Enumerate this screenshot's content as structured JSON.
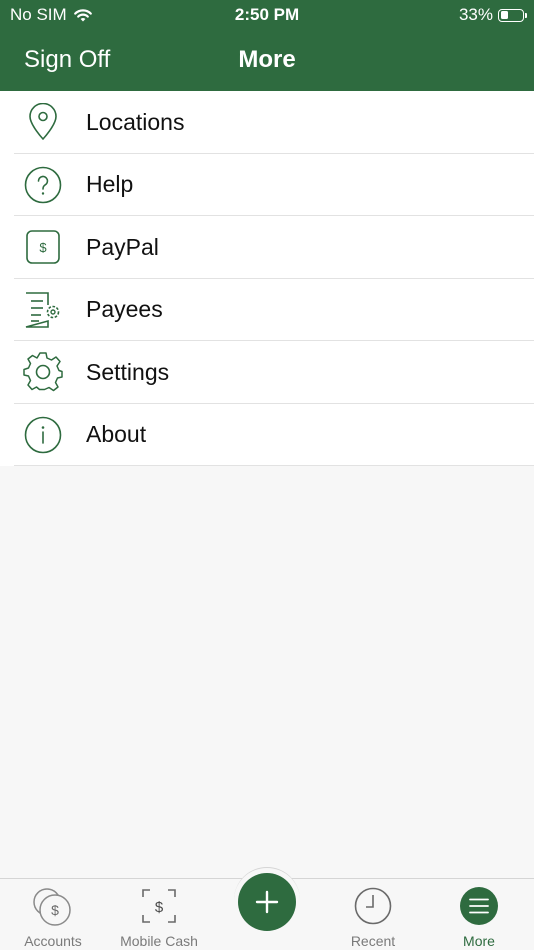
{
  "status_bar": {
    "carrier": "No SIM",
    "time": "2:50 PM",
    "battery": "33%",
    "battery_level": 0.33
  },
  "nav": {
    "left_button": "Sign Off",
    "title": "More"
  },
  "menu": {
    "items": [
      {
        "label": "Locations",
        "icon": "location-pin-icon"
      },
      {
        "label": "Help",
        "icon": "question-circle-icon"
      },
      {
        "label": "PayPal",
        "icon": "paypal-dollar-icon"
      },
      {
        "label": "Payees",
        "icon": "payees-document-icon"
      },
      {
        "label": "Settings",
        "icon": "gear-icon"
      },
      {
        "label": "About",
        "icon": "info-circle-icon"
      }
    ]
  },
  "tabs": {
    "items": [
      {
        "label": "Accounts",
        "icon": "accounts-coins-icon",
        "active": false
      },
      {
        "label": "Mobile Cash",
        "icon": "mobile-cash-icon",
        "active": false
      },
      {
        "label": "",
        "icon": "plus-icon",
        "active": false
      },
      {
        "label": "Recent",
        "icon": "clock-icon",
        "active": false
      },
      {
        "label": "More",
        "icon": "menu-lines-icon",
        "active": true
      }
    ]
  },
  "colors": {
    "brand_green": "#2e6b3f",
    "background": "#f7f7f7",
    "tab_inactive": "#7a7a7a"
  }
}
